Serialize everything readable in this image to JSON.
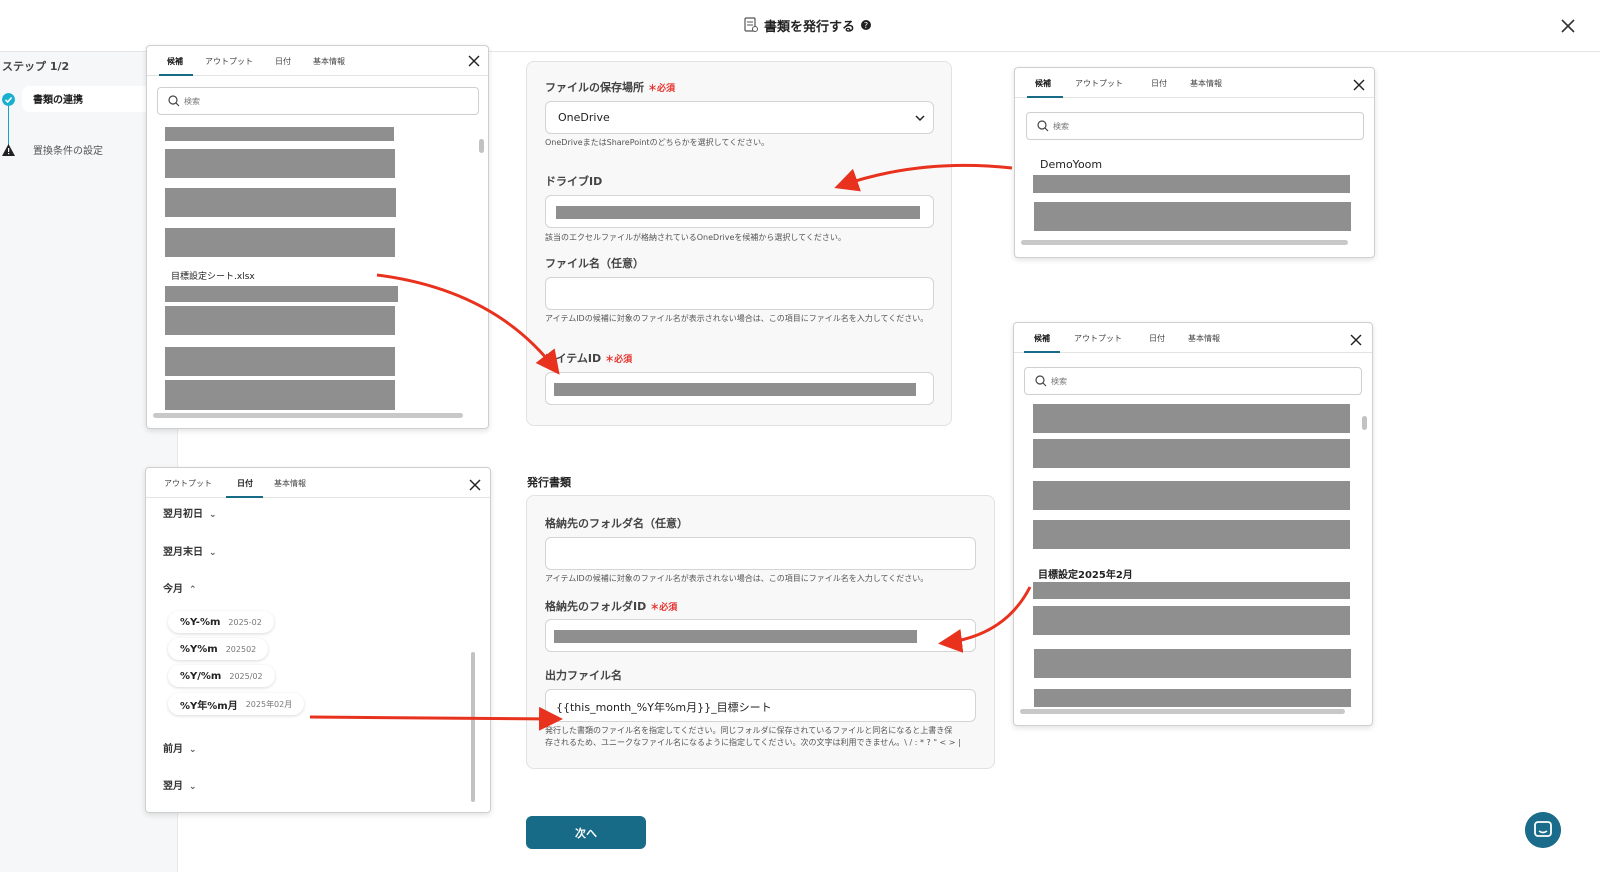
{
  "header": {
    "title": "書類を発行する"
  },
  "sidebar": {
    "step_counter": "ステップ 1/2",
    "steps": [
      {
        "label": "書類の連携",
        "status": "complete"
      },
      {
        "label": "置換条件の設定",
        "status": "warning"
      }
    ]
  },
  "popup_left_top": {
    "tabs": [
      "候補",
      "アウトプット",
      "日付",
      "基本情報"
    ],
    "active_tab": "候補",
    "search_placeholder": "検索",
    "visible_item": "目標設定シート.xlsx"
  },
  "popup_right_top": {
    "tabs": [
      "候補",
      "アウトプット",
      "日付",
      "基本情報"
    ],
    "active_tab": "候補",
    "search_placeholder": "検索",
    "visible_item": "DemoYoom"
  },
  "popup_right_bottom": {
    "tabs": [
      "候補",
      "アウトプット",
      "日付",
      "基本情報"
    ],
    "active_tab": "候補",
    "search_placeholder": "検索",
    "visible_item": "目標設定2025年2月"
  },
  "popup_left_bottom": {
    "tabs": [
      "アウトプット",
      "日付",
      "基本情報"
    ],
    "active_tab": "日付",
    "groups": {
      "next_month_first": "翌月初日",
      "next_month_last": "翌月末日",
      "this_month": "今月",
      "prev_month": "前月",
      "next_month": "翌月"
    },
    "formats": [
      {
        "key": "%Y-%m",
        "example": "2025-02"
      },
      {
        "key": "%Y%m",
        "example": "202502"
      },
      {
        "key": "%Y/%m",
        "example": "2025/02"
      },
      {
        "key": "%Y年%m月",
        "example": "2025年02月"
      }
    ]
  },
  "form_top": {
    "storage_label": "ファイルの保存場所",
    "storage_value": "OneDrive",
    "storage_help": "OneDriveまたはSharePointのどちらかを選択してください。",
    "drive_label": "ドライブID",
    "drive_help": "該当のエクセルファイルが格納されているOneDriveを候補から選択してください。",
    "filename_label": "ファイル名（任意）",
    "filename_help": "アイテムIDの候補に対象のファイル名が表示されない場合は、この項目にファイル名を入力してください。",
    "item_label": "アイテムID",
    "required": "必須"
  },
  "section_title": "発行書類",
  "form_bottom": {
    "folder_name_label": "格納先のフォルダ名（任意）",
    "folder_name_help": "アイテムIDの候補に対象のファイル名が表示されない場合は、この項目にファイル名を入力してください。",
    "folder_id_label": "格納先のフォルダID",
    "required": "必須",
    "output_label": "出力ファイル名",
    "output_value": "{{this_month_%Y年%m月}}_目標シート",
    "output_help_1": "発行した書類のファイル名を指定してください。同じフォルダに保存されているファイルと同名になると上書き保",
    "output_help_2": "存されるため、ユニークなファイル名になるように指定してください。次の文字は利用できません。\\ / : * ? \" < > |"
  },
  "next_button": "次へ",
  "colors": {
    "accent": "#176b87",
    "required": "#e5322d",
    "arrow": "#e8321e",
    "redaction": "#8f8f8f"
  }
}
